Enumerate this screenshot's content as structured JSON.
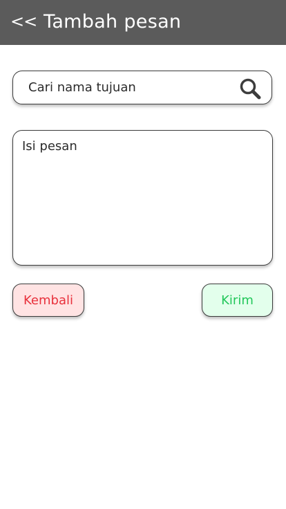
{
  "header": {
    "back_label": "<<",
    "title": "Tambah pesan",
    "background_color": "#5b5b5b"
  },
  "search": {
    "placeholder": "Cari nama tujuan",
    "icon": "search-icon"
  },
  "message": {
    "placeholder": "Isi pesan"
  },
  "actions": {
    "back_label": "Kembali",
    "back_color": "#e8313c",
    "back_bg": "#ffe3e3",
    "send_label": "Kirim",
    "send_color": "#22c75a",
    "send_bg": "#e3ffec"
  }
}
